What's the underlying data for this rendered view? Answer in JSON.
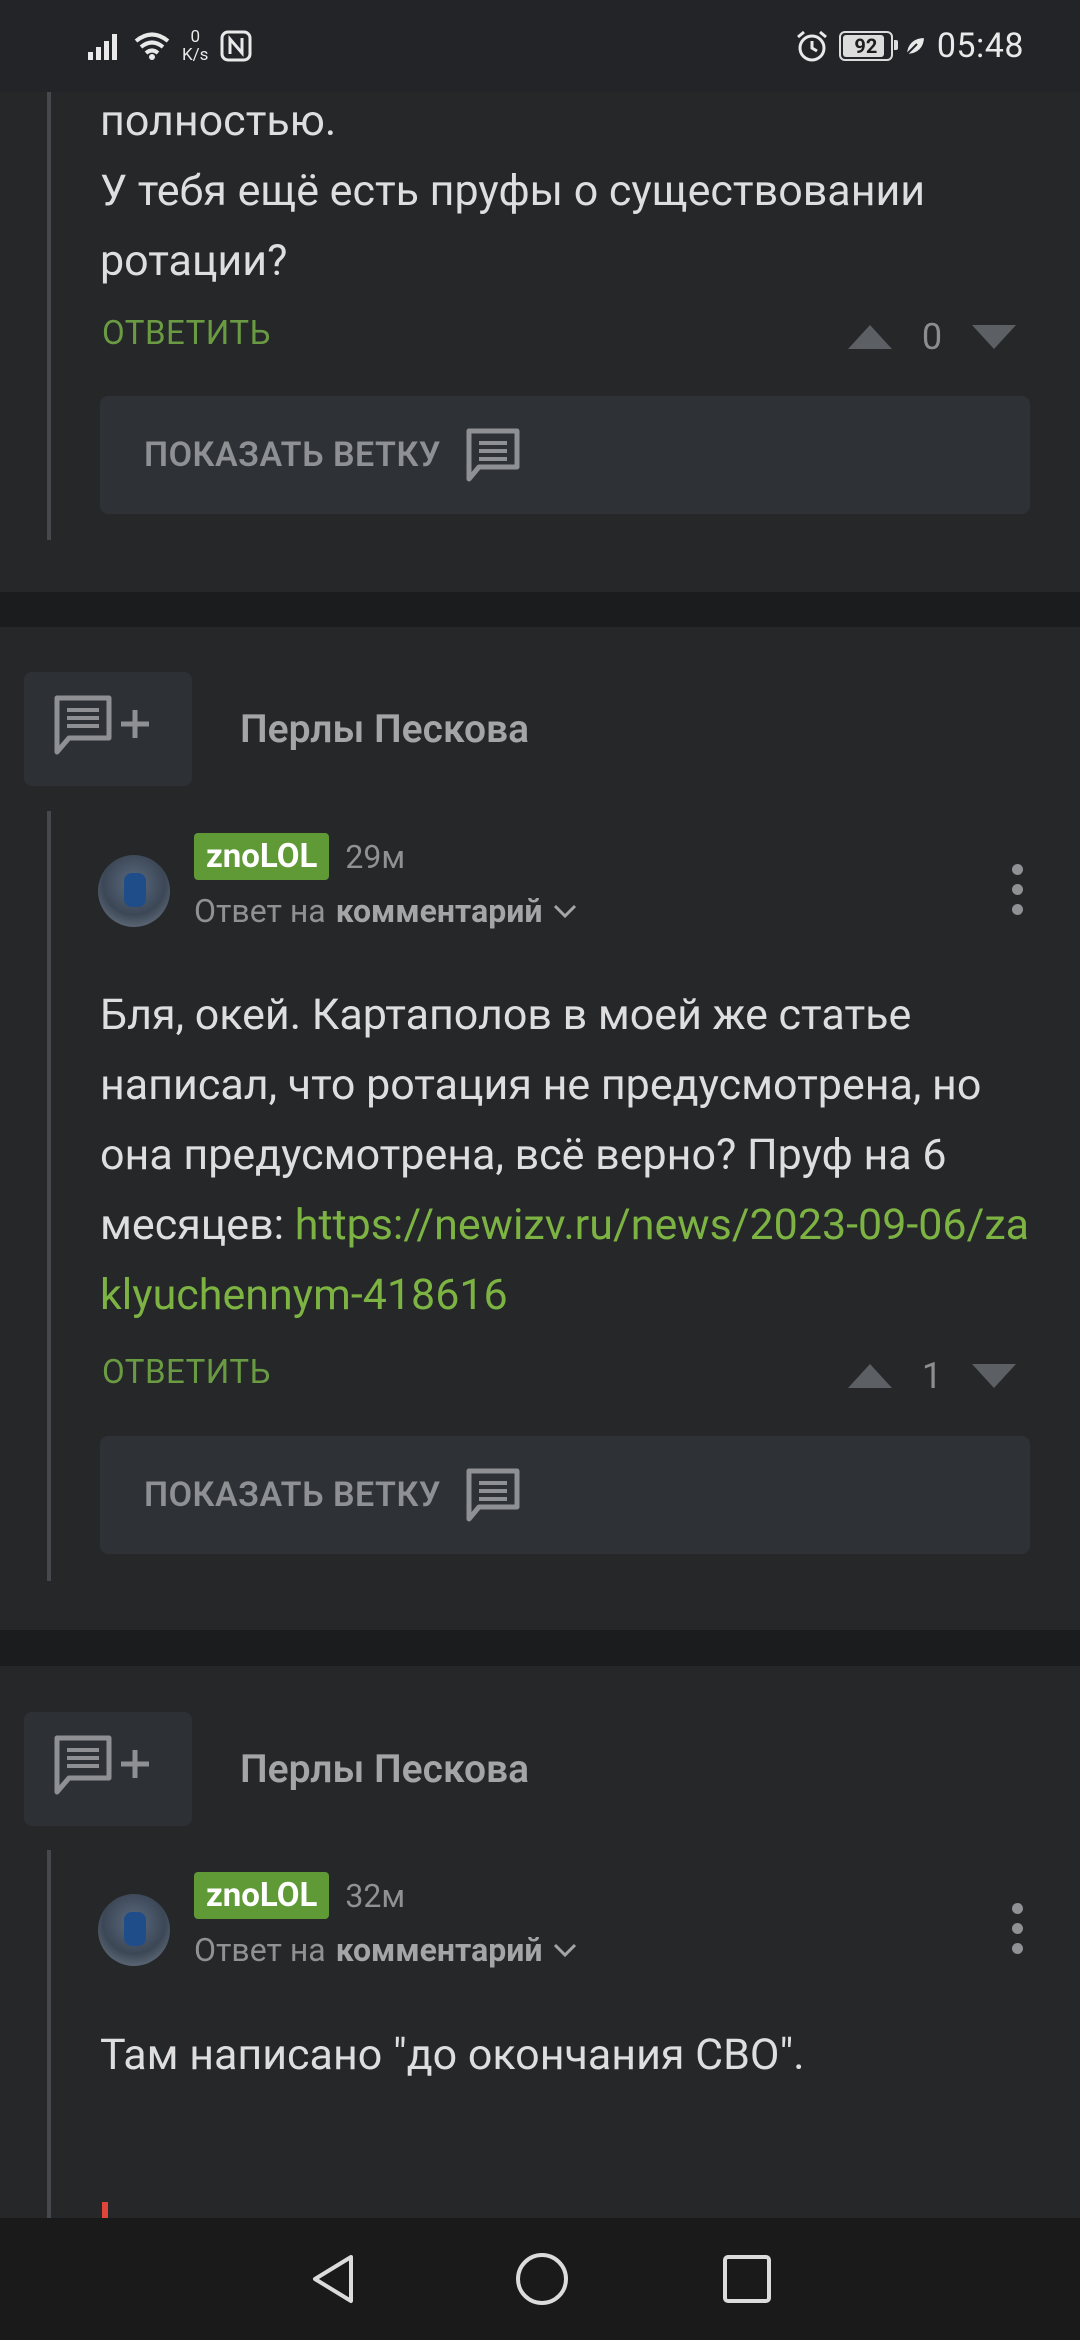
{
  "status_bar": {
    "time": "05:48",
    "battery": "92",
    "net_speed_value": "0",
    "net_speed_unit": "K/s"
  },
  "colors": {
    "background": "#1b1c1e",
    "card": "#252729",
    "link": "#7cb342",
    "reply": "#6a9b43",
    "nick_badge": "#5f9a37"
  },
  "comment0": {
    "text_lines": [
      "полностью.",
      "У тебя ещё есть пруфы о существовании ротации?"
    ],
    "reply_label": "ОТВЕТИТЬ",
    "rating": "0",
    "show_branch_label": "ПОКАЗАТЬ ВЕТКУ"
  },
  "post1": {
    "title": "Перлы Пескова",
    "comment": {
      "nick": "znoLOL",
      "ago": "29м",
      "reply_prefix": "Ответ на",
      "reply_target": "комментарий",
      "text": "Бля, окей. Картаполов в моей же статье написал, что ротация не предусмотрена, но она предусмотрена, всё верно?",
      "text2": "Пруф на 6 месяцев: ",
      "link": "https://newizv.ru/news/2023-09-06/zaklyuchennym-418616",
      "reply_label": "ОТВЕТИТЬ",
      "rating": "1",
      "show_branch_label": "ПОКАЗАТЬ ВЕТКУ"
    }
  },
  "post2": {
    "title": "Перлы Пескова",
    "comment": {
      "nick": "znoLOL",
      "ago": "32м",
      "reply_prefix": "Ответ на",
      "reply_target": "комментарий",
      "text": "Там написано \"до окончания СВО\"."
    }
  },
  "icons": [
    "signal-icon",
    "wifi-icon",
    "nfc-icon",
    "alarm-icon",
    "battery-icon",
    "leaf-icon",
    "upvote-icon",
    "downvote-icon",
    "comment-icon",
    "add-comment-icon",
    "chevron-down-icon",
    "more-vert-icon",
    "back-icon",
    "home-icon",
    "recents-icon"
  ]
}
